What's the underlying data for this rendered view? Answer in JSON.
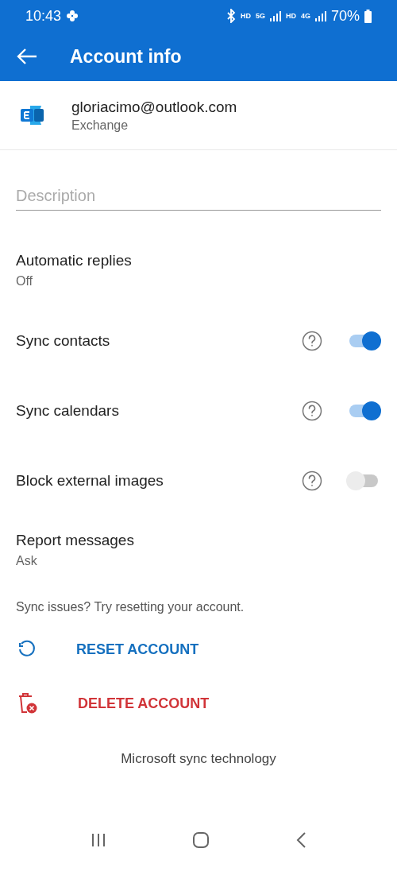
{
  "status_bar": {
    "time": "10:43",
    "network_labels": [
      "HD",
      "5G",
      "HD",
      "4G"
    ],
    "battery": "70%"
  },
  "app_bar": {
    "title": "Account info"
  },
  "account": {
    "email": "gloriacimo@outlook.com",
    "type": "Exchange"
  },
  "description": {
    "placeholder": "Description"
  },
  "settings": [
    {
      "kind": "detail",
      "title": "Automatic replies",
      "subtitle": "Off"
    },
    {
      "kind": "toggle",
      "title": "Sync contacts",
      "on": true
    },
    {
      "kind": "toggle",
      "title": "Sync calendars",
      "on": true
    },
    {
      "kind": "toggle",
      "title": "Block external images",
      "on": false
    },
    {
      "kind": "detail",
      "title": "Report messages",
      "subtitle": "Ask"
    }
  ],
  "hint": "Sync issues? Try resetting your account.",
  "actions": [
    {
      "kind": "reset",
      "label": "RESET ACCOUNT"
    },
    {
      "kind": "delete",
      "label": "DELETE ACCOUNT"
    }
  ],
  "footer": "Microsoft sync technology"
}
